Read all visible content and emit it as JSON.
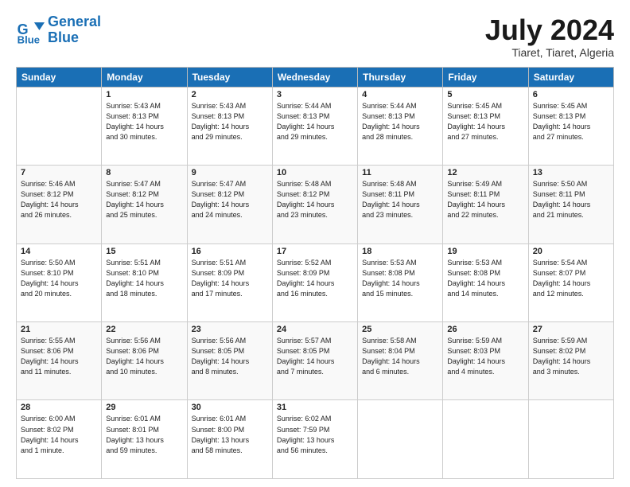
{
  "logo": {
    "line1": "General",
    "line2": "Blue"
  },
  "title": "July 2024",
  "subtitle": "Tiaret, Tiaret, Algeria",
  "days_of_week": [
    "Sunday",
    "Monday",
    "Tuesday",
    "Wednesday",
    "Thursday",
    "Friday",
    "Saturday"
  ],
  "weeks": [
    [
      {
        "num": "",
        "info": ""
      },
      {
        "num": "1",
        "info": "Sunrise: 5:43 AM\nSunset: 8:13 PM\nDaylight: 14 hours\nand 30 minutes."
      },
      {
        "num": "2",
        "info": "Sunrise: 5:43 AM\nSunset: 8:13 PM\nDaylight: 14 hours\nand 29 minutes."
      },
      {
        "num": "3",
        "info": "Sunrise: 5:44 AM\nSunset: 8:13 PM\nDaylight: 14 hours\nand 29 minutes."
      },
      {
        "num": "4",
        "info": "Sunrise: 5:44 AM\nSunset: 8:13 PM\nDaylight: 14 hours\nand 28 minutes."
      },
      {
        "num": "5",
        "info": "Sunrise: 5:45 AM\nSunset: 8:13 PM\nDaylight: 14 hours\nand 27 minutes."
      },
      {
        "num": "6",
        "info": "Sunrise: 5:45 AM\nSunset: 8:13 PM\nDaylight: 14 hours\nand 27 minutes."
      }
    ],
    [
      {
        "num": "7",
        "info": "Sunrise: 5:46 AM\nSunset: 8:12 PM\nDaylight: 14 hours\nand 26 minutes."
      },
      {
        "num": "8",
        "info": "Sunrise: 5:47 AM\nSunset: 8:12 PM\nDaylight: 14 hours\nand 25 minutes."
      },
      {
        "num": "9",
        "info": "Sunrise: 5:47 AM\nSunset: 8:12 PM\nDaylight: 14 hours\nand 24 minutes."
      },
      {
        "num": "10",
        "info": "Sunrise: 5:48 AM\nSunset: 8:12 PM\nDaylight: 14 hours\nand 23 minutes."
      },
      {
        "num": "11",
        "info": "Sunrise: 5:48 AM\nSunset: 8:11 PM\nDaylight: 14 hours\nand 23 minutes."
      },
      {
        "num": "12",
        "info": "Sunrise: 5:49 AM\nSunset: 8:11 PM\nDaylight: 14 hours\nand 22 minutes."
      },
      {
        "num": "13",
        "info": "Sunrise: 5:50 AM\nSunset: 8:11 PM\nDaylight: 14 hours\nand 21 minutes."
      }
    ],
    [
      {
        "num": "14",
        "info": "Sunrise: 5:50 AM\nSunset: 8:10 PM\nDaylight: 14 hours\nand 20 minutes."
      },
      {
        "num": "15",
        "info": "Sunrise: 5:51 AM\nSunset: 8:10 PM\nDaylight: 14 hours\nand 18 minutes."
      },
      {
        "num": "16",
        "info": "Sunrise: 5:51 AM\nSunset: 8:09 PM\nDaylight: 14 hours\nand 17 minutes."
      },
      {
        "num": "17",
        "info": "Sunrise: 5:52 AM\nSunset: 8:09 PM\nDaylight: 14 hours\nand 16 minutes."
      },
      {
        "num": "18",
        "info": "Sunrise: 5:53 AM\nSunset: 8:08 PM\nDaylight: 14 hours\nand 15 minutes."
      },
      {
        "num": "19",
        "info": "Sunrise: 5:53 AM\nSunset: 8:08 PM\nDaylight: 14 hours\nand 14 minutes."
      },
      {
        "num": "20",
        "info": "Sunrise: 5:54 AM\nSunset: 8:07 PM\nDaylight: 14 hours\nand 12 minutes."
      }
    ],
    [
      {
        "num": "21",
        "info": "Sunrise: 5:55 AM\nSunset: 8:06 PM\nDaylight: 14 hours\nand 11 minutes."
      },
      {
        "num": "22",
        "info": "Sunrise: 5:56 AM\nSunset: 8:06 PM\nDaylight: 14 hours\nand 10 minutes."
      },
      {
        "num": "23",
        "info": "Sunrise: 5:56 AM\nSunset: 8:05 PM\nDaylight: 14 hours\nand 8 minutes."
      },
      {
        "num": "24",
        "info": "Sunrise: 5:57 AM\nSunset: 8:05 PM\nDaylight: 14 hours\nand 7 minutes."
      },
      {
        "num": "25",
        "info": "Sunrise: 5:58 AM\nSunset: 8:04 PM\nDaylight: 14 hours\nand 6 minutes."
      },
      {
        "num": "26",
        "info": "Sunrise: 5:59 AM\nSunset: 8:03 PM\nDaylight: 14 hours\nand 4 minutes."
      },
      {
        "num": "27",
        "info": "Sunrise: 5:59 AM\nSunset: 8:02 PM\nDaylight: 14 hours\nand 3 minutes."
      }
    ],
    [
      {
        "num": "28",
        "info": "Sunrise: 6:00 AM\nSunset: 8:02 PM\nDaylight: 14 hours\nand 1 minute."
      },
      {
        "num": "29",
        "info": "Sunrise: 6:01 AM\nSunset: 8:01 PM\nDaylight: 13 hours\nand 59 minutes."
      },
      {
        "num": "30",
        "info": "Sunrise: 6:01 AM\nSunset: 8:00 PM\nDaylight: 13 hours\nand 58 minutes."
      },
      {
        "num": "31",
        "info": "Sunrise: 6:02 AM\nSunset: 7:59 PM\nDaylight: 13 hours\nand 56 minutes."
      },
      {
        "num": "",
        "info": ""
      },
      {
        "num": "",
        "info": ""
      },
      {
        "num": "",
        "info": ""
      }
    ]
  ]
}
